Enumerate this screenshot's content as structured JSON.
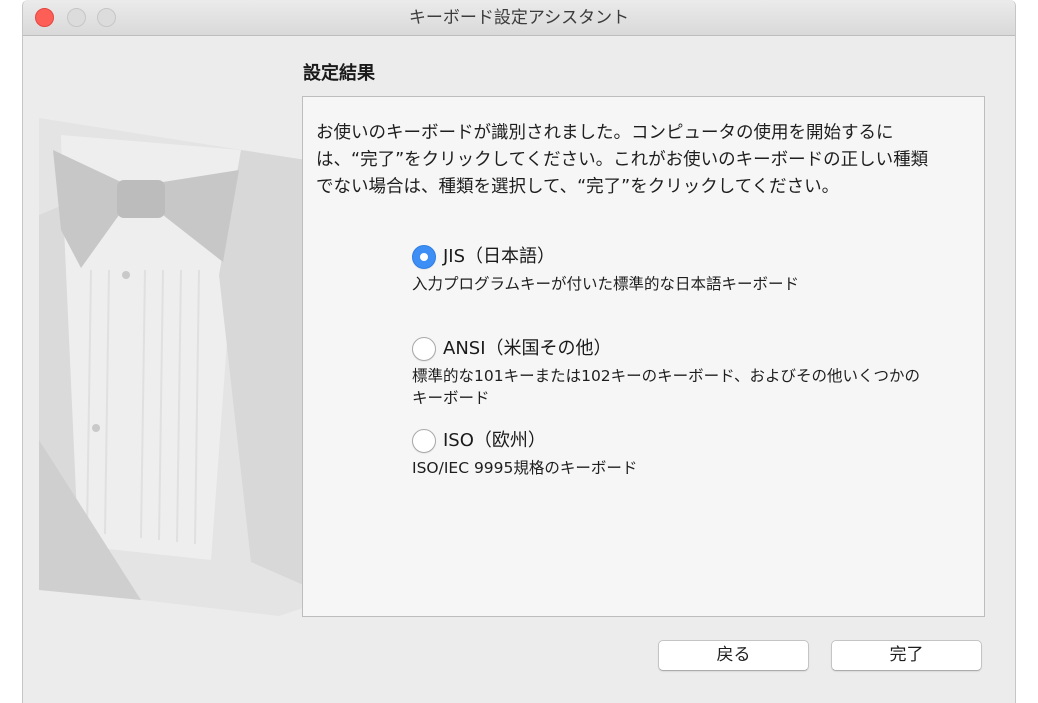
{
  "window": {
    "title": "キーボード設定アシスタント"
  },
  "section": {
    "heading": "設定結果"
  },
  "message": {
    "lines": [
      "お使いのキーボードが識別されました。コンピュータの使用を開始するに",
      "は、“完了”をクリックしてください。これがお使いのキーボードの正しい種類",
      "でない場合は、種類を選択して、“完了”をクリックしてください。"
    ]
  },
  "keyboard_types": [
    {
      "label": "JIS（日本語）",
      "description": [
        "入力プログラムキーが付いた標準的な日本語キーボード"
      ],
      "selected": true
    },
    {
      "label": "ANSI（米国その他）",
      "description": [
        "標準的な101キーまたは102キーのキーボード、およびその他いくつかの",
        "キーボード"
      ],
      "selected": false
    },
    {
      "label": "ISO（欧州）",
      "description": [
        "ISO/IEC 9995規格のキーボード"
      ],
      "selected": false
    }
  ],
  "buttons": {
    "back": "戻る",
    "done": "完了"
  },
  "icons": {
    "close": "close-button-icon",
    "minimize": "minimize-button-icon",
    "zoom": "zoom-button-icon",
    "illustration": "tuxedo-illustration"
  },
  "colors": {
    "accent": "#3d8ff5",
    "close_button": "#fd5f57",
    "inactive_button": "#dcdcdc",
    "window_background": "#ececec",
    "panel_background": "#f6f6f6"
  }
}
